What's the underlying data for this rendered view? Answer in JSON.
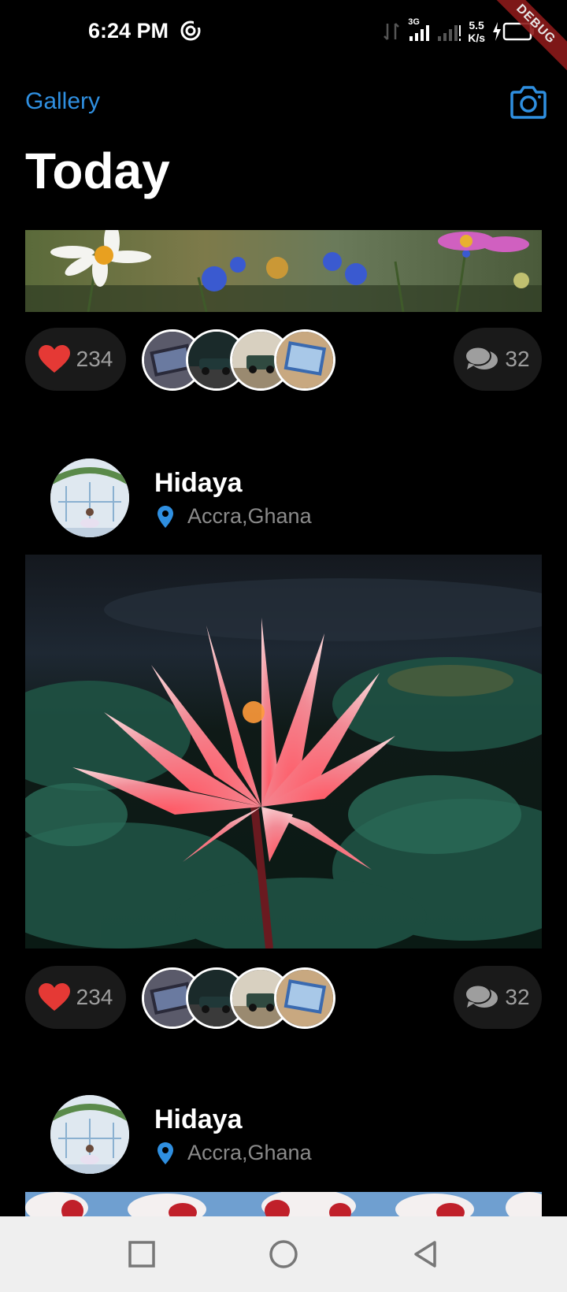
{
  "status_bar": {
    "time": "6:24 PM",
    "network": "3G",
    "net_speed_value": "5.5",
    "net_speed_unit": "K/s",
    "debug_label": "DEBUG"
  },
  "header": {
    "gallery_label": "Gallery",
    "camera_icon": "camera-icon",
    "title": "Today",
    "accent_color": "#2f8fe0"
  },
  "posts": [
    {
      "image": "wildflowers-banner",
      "likes": "234",
      "comments": "32"
    },
    {
      "user_name": "Hidaya",
      "location": "Accra,Ghana",
      "image": "pink-water-lily",
      "likes": "234",
      "comments": "32"
    },
    {
      "user_name": "Hidaya",
      "location": "Accra,Ghana",
      "image": "red-white-tulips"
    }
  ],
  "like_color": "#e53935",
  "nav": [
    "recents-square-icon",
    "home-circle-icon",
    "back-triangle-icon"
  ]
}
